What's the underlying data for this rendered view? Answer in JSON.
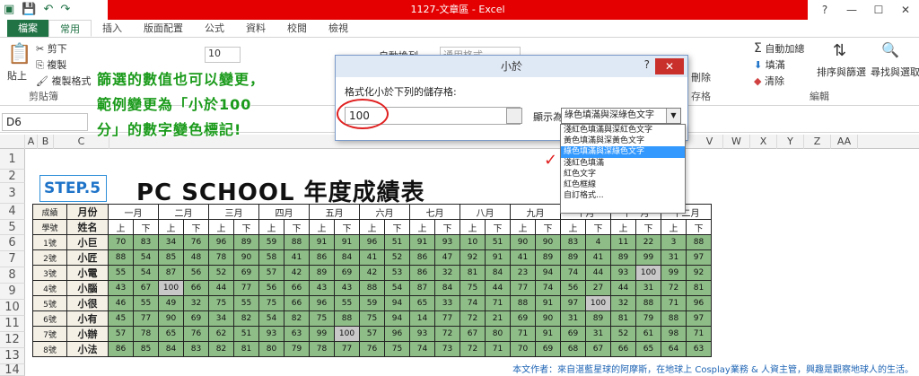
{
  "window": {
    "title": "1127-文章區 - Excel",
    "controls": [
      "?",
      "—",
      "☐",
      "✕"
    ]
  },
  "tabs": [
    "檔案",
    "常用",
    "插入",
    "版面配置",
    "公式",
    "資料",
    "校閱",
    "檢視"
  ],
  "ribbon": {
    "clipboard": {
      "cut": "剪下",
      "copy": "複製",
      "format_painter": "複製格式",
      "paste": "貼上",
      "label": "剪貼簿"
    },
    "font_size": "10",
    "wrap": "自動換列",
    "number_format": "通用格式",
    "delete": "刪除",
    "cells_label": "存格",
    "editing": {
      "autosum": "自動加總",
      "fill": "填滿",
      "clear": "清除",
      "sort": "排序與篩選",
      "find": "尋找與選取",
      "label": "編輯"
    }
  },
  "namebox": "D6",
  "annotation": {
    "line1": "篩選的數值也可以變更，",
    "line2": "範例變更為「小於100",
    "line3": "分」的數字變色標記!"
  },
  "dialog": {
    "title": "小於",
    "help": "?",
    "close": "✕",
    "label": "格式化小於下列的儲存格:",
    "value": "100",
    "show_as": "顯示為",
    "selected": "綠色填滿與深綠色文字",
    "options": [
      "淺紅色填滿與深紅色文字",
      "黃色填滿與深黃色文字",
      "綠色填滿與深綠色文字",
      "淺紅色填滿",
      "紅色文字",
      "紅色框線",
      "自訂格式..."
    ]
  },
  "sheet": {
    "step": "STEP.5",
    "title": "PC SCHOOL 年度成績表",
    "header_left_top": [
      "成績",
      "月份"
    ],
    "header_left_bottom": [
      "學號",
      "姓名"
    ],
    "months": [
      "一月",
      "二月",
      "三月",
      "四月",
      "五月",
      "六月",
      "七月",
      "八月",
      "九月",
      "十月",
      "十一月",
      "十二月"
    ],
    "half": [
      "上",
      "下"
    ],
    "rows": [
      {
        "id": "1號",
        "name": "小巨",
        "scores": [
          "70",
          "83",
          "34",
          "76",
          "96",
          "89",
          "59",
          "88",
          "91",
          "91",
          "96",
          "51",
          "91",
          "93",
          "10",
          "51",
          "90",
          "90",
          "83",
          "4",
          "11",
          "22",
          "3",
          "88"
        ]
      },
      {
        "id": "2號",
        "name": "小匠",
        "scores": [
          "88",
          "54",
          "85",
          "48",
          "78",
          "90",
          "58",
          "41",
          "86",
          "84",
          "41",
          "52",
          "86",
          "47",
          "92",
          "91",
          "41",
          "89",
          "89",
          "41",
          "89",
          "99",
          "31",
          "97"
        ]
      },
      {
        "id": "3號",
        "name": "小電",
        "scores": [
          "55",
          "54",
          "87",
          "56",
          "52",
          "69",
          "57",
          "42",
          "89",
          "69",
          "42",
          "53",
          "86",
          "32",
          "81",
          "84",
          "23",
          "94",
          "74",
          "44",
          "93",
          "100",
          "99",
          "92"
        ]
      },
      {
        "id": "4號",
        "name": "小腦",
        "scores": [
          "43",
          "67",
          "100",
          "66",
          "44",
          "77",
          "56",
          "66",
          "43",
          "43",
          "88",
          "54",
          "87",
          "84",
          "75",
          "44",
          "77",
          "74",
          "56",
          "27",
          "44",
          "31",
          "72",
          "81"
        ]
      },
      {
        "id": "5號",
        "name": "小很",
        "scores": [
          "46",
          "55",
          "49",
          "32",
          "75",
          "55",
          "75",
          "66",
          "96",
          "55",
          "59",
          "94",
          "65",
          "33",
          "74",
          "71",
          "88",
          "91",
          "97",
          "100",
          "32",
          "88",
          "71",
          "96"
        ]
      },
      {
        "id": "6號",
        "name": "小有",
        "scores": [
          "45",
          "77",
          "90",
          "69",
          "34",
          "82",
          "54",
          "82",
          "75",
          "88",
          "75",
          "94",
          "14",
          "77",
          "72",
          "21",
          "69",
          "90",
          "31",
          "89",
          "81",
          "79",
          "88",
          "97"
        ]
      },
      {
        "id": "7號",
        "name": "小辦",
        "scores": [
          "57",
          "78",
          "65",
          "76",
          "62",
          "51",
          "93",
          "63",
          "99",
          "100",
          "57",
          "96",
          "93",
          "72",
          "67",
          "80",
          "71",
          "91",
          "69",
          "31",
          "52",
          "61",
          "98",
          "71"
        ]
      },
      {
        "id": "8號",
        "name": "小法",
        "scores": [
          "86",
          "85",
          "84",
          "83",
          "82",
          "81",
          "80",
          "79",
          "78",
          "77",
          "76",
          "75",
          "74",
          "73",
          "72",
          "71",
          "70",
          "69",
          "68",
          "67",
          "66",
          "65",
          "64",
          "63"
        ]
      }
    ]
  },
  "colors": {
    "green_fill": "#8fbd88",
    "highlight": "#c8c8c8",
    "excel_green": "#217346",
    "red": "#e02020"
  },
  "footer": "本文作者：來自湛藍星球的阿摩斯，在地球上 Cosplay業務 & 人資主管，興趣是觀察地球人的生活。"
}
